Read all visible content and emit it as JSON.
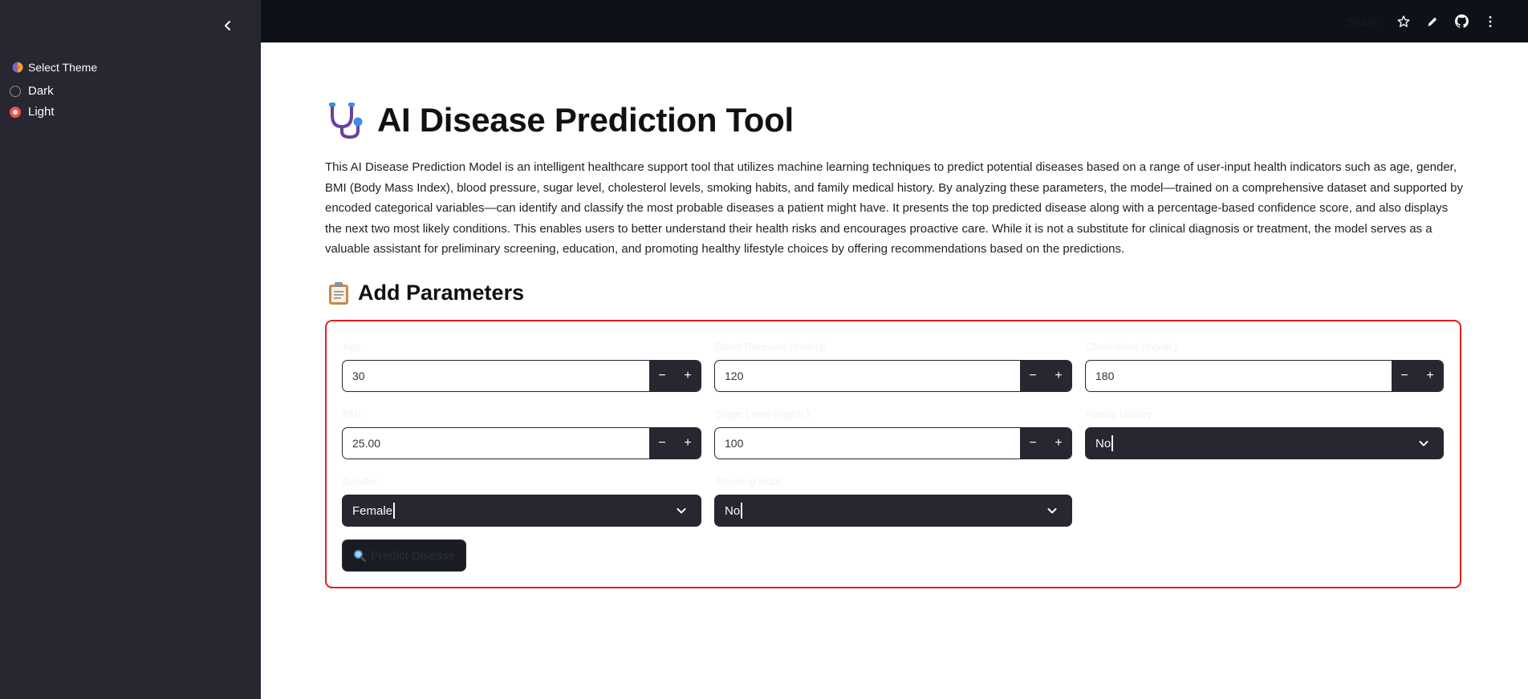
{
  "sidebar": {
    "collapse_icon": "chevron-left-icon",
    "theme_label": "Select Theme",
    "theme_icon": "palette-icon",
    "options": [
      {
        "label": "Dark",
        "checked": false
      },
      {
        "label": "Light",
        "checked": true
      }
    ]
  },
  "header": {
    "share_label": "Share",
    "icons": [
      "star-icon",
      "edit-icon",
      "github-icon",
      "more-vertical-icon"
    ]
  },
  "main": {
    "title": "AI Disease Prediction Tool",
    "title_icon": "stethoscope-icon",
    "description": "This AI Disease Prediction Model is an intelligent healthcare support tool that utilizes machine learning techniques to predict potential diseases based on a range of user-input health indicators such as age, gender, BMI (Body Mass Index), blood pressure, sugar level, cholesterol levels, smoking habits, and family medical history. By analyzing these parameters, the model—trained on a comprehensive dataset and supported by encoded categorical variables—can identify and classify the most probable diseases a patient might have. It presents the top predicted disease along with a percentage-based confidence score, and also displays the next two most likely conditions. This enables users to better understand their health risks and encourages proactive care. While it is not a substitute for clinical diagnosis or treatment, the model serves as a valuable assistant for preliminary screening, education, and promoting healthy lifestyle choices by offering recommendations based on the predictions.",
    "subheading": "Add Parameters",
    "subheading_icon": "clipboard-icon"
  },
  "form": {
    "age": {
      "label": "Age",
      "value": "30"
    },
    "blood_pressure": {
      "label": "Blood Pressure (mmHg)",
      "value": "120"
    },
    "cholesterol": {
      "label": "Cholesterol (mg/dL)",
      "value": "180"
    },
    "bmi": {
      "label": "BMI",
      "value": "25.00"
    },
    "sugar": {
      "label": "Sugar Level (mg/dL)",
      "value": "100"
    },
    "family_history": {
      "label": "Family History",
      "value": "No"
    },
    "gender": {
      "label": "Gender",
      "value": "Female"
    },
    "smoking": {
      "label": "Smoking Habit",
      "value": "No"
    },
    "minus": "−",
    "plus": "+",
    "predict_label": "Predict Disease",
    "predict_icon": "magnifier-icon"
  },
  "colors": {
    "sidebar_bg": "#262730",
    "topbar_bg": "#0e1117",
    "accent_red": "#ff4b4b",
    "form_border": "#e0201e"
  }
}
